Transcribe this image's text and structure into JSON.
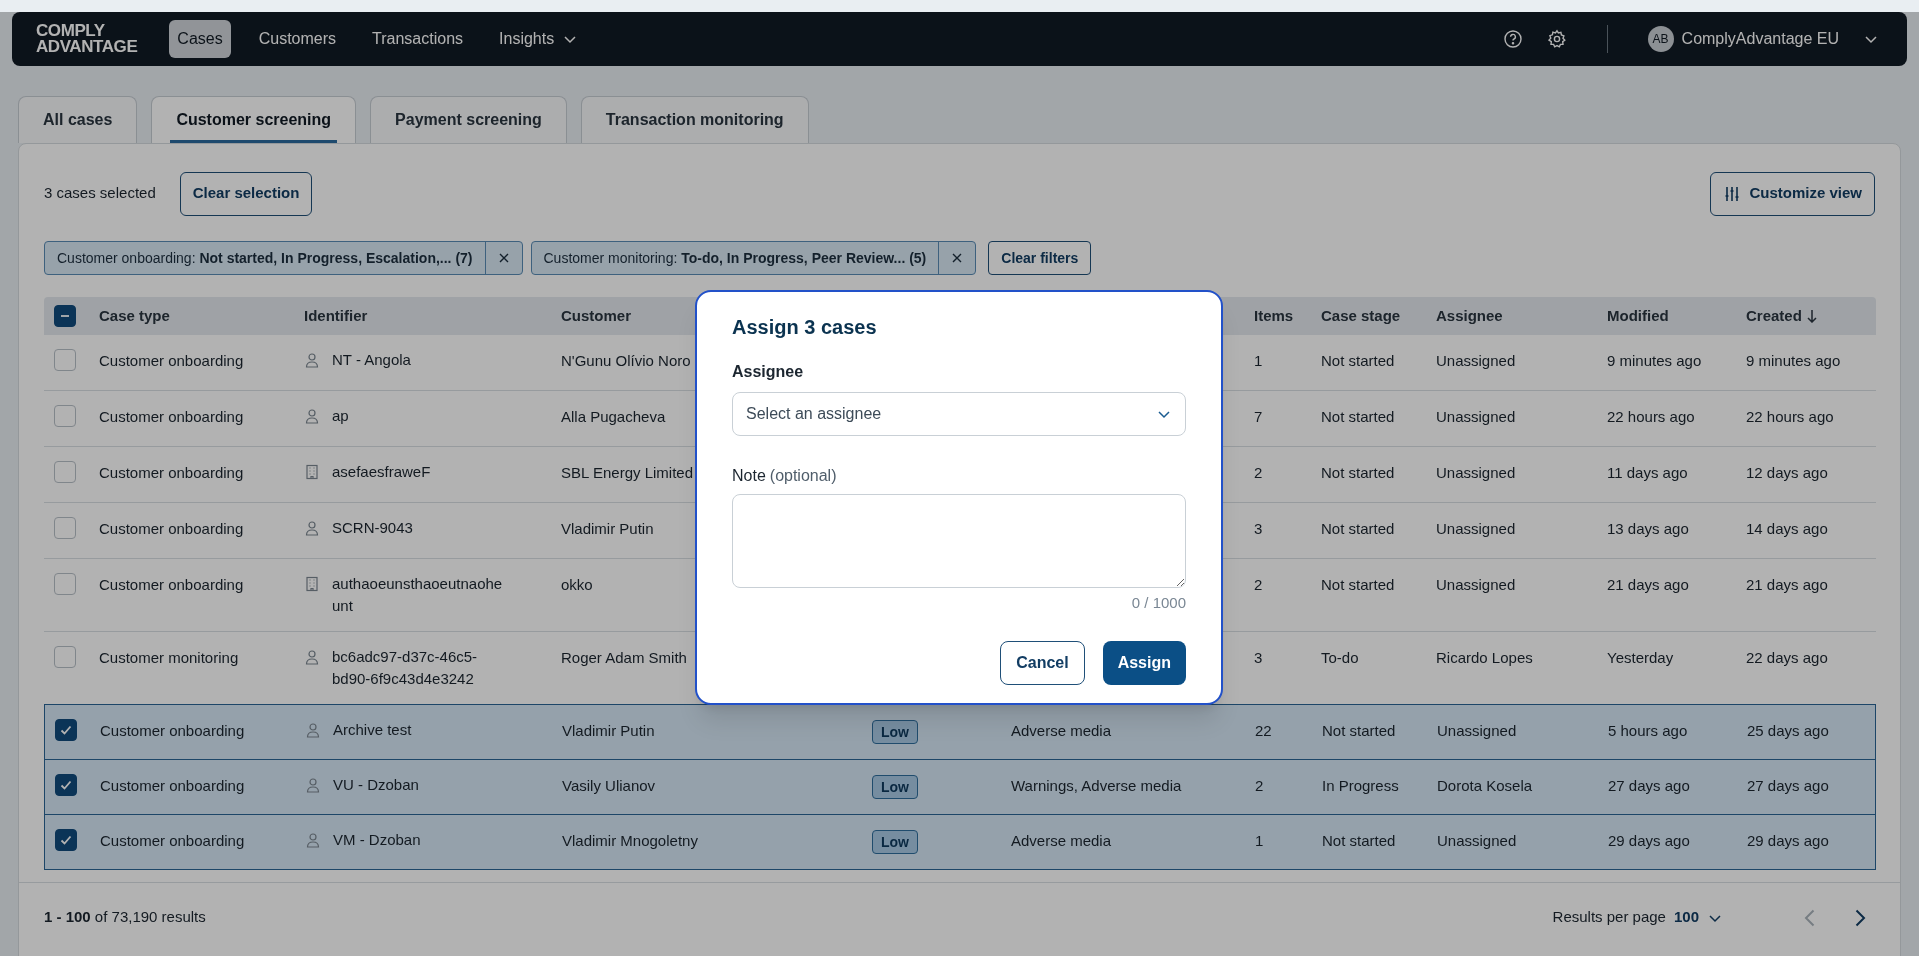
{
  "nav": {
    "logo_line_1": "COMPLY",
    "logo_line_2": "ADVANTAGE",
    "items": [
      {
        "label": "Cases",
        "selected": true,
        "kind": "link"
      },
      {
        "label": "Customers",
        "selected": false,
        "kind": "link"
      },
      {
        "label": "Transactions",
        "selected": false,
        "kind": "link"
      },
      {
        "label": "Insights",
        "selected": false,
        "kind": "dropdown"
      }
    ],
    "avatar_initials": "AB",
    "account": "ComplyAdvantage EU"
  },
  "tabs": [
    {
      "label": "All cases",
      "selected": false
    },
    {
      "label": "Customer screening",
      "selected": true
    },
    {
      "label": "Payment screening",
      "selected": false
    },
    {
      "label": "Transaction monitoring",
      "selected": false
    }
  ],
  "selection": {
    "count_text": "3 cases selected",
    "clear_button": "Clear selection"
  },
  "customize_button": "Customize view",
  "filters": [
    {
      "text": "Customer onboarding: **Not started, In Progress, Escalation,... (7)**"
    },
    {
      "text": "Customer monitoring: **To-do, In Progress, Peer Review... (5)**"
    }
  ],
  "clear_filters": "Clear filters",
  "table": {
    "select_all_indeterminate": true,
    "columns": [
      {
        "label": "Case type"
      },
      {
        "label": "Identifier"
      },
      {
        "label": "Customer"
      },
      {},
      {},
      {
        "label": "Items"
      },
      {
        "label": "Case stage"
      },
      {
        "label": "Assignee"
      },
      {
        "label": "Modified"
      },
      {
        "label": "Created",
        "sorted_descending": true
      }
    ],
    "rows": [
      {
        "selected": false,
        "case_type": "Customer onboarding",
        "identifier": {
          "kind": "person",
          "text": "NT - Angola"
        },
        "customer": "N'Gunu Olívio Noro",
        "items": "1",
        "case_stage": "Not started",
        "assignee": "Unassigned",
        "modified": "9 minutes ago",
        "created": "9 minutes ago"
      },
      {
        "selected": false,
        "case_type": "Customer onboarding",
        "identifier": {
          "kind": "person",
          "text": "ap"
        },
        "customer": "Alla Pugacheva",
        "items": "7",
        "case_stage": "Not started",
        "assignee": "Unassigned",
        "modified": "22 hours ago",
        "created": "22 hours ago"
      },
      {
        "selected": false,
        "case_type": "Customer onboarding",
        "identifier": {
          "kind": "company",
          "text": "asefaesfraweF"
        },
        "customer": "SBL Energy Limited",
        "items": "2",
        "case_stage": "Not started",
        "assignee": "Unassigned",
        "modified": "11 days ago",
        "created": "12 days ago"
      },
      {
        "selected": false,
        "case_type": "Customer onboarding",
        "identifier": {
          "kind": "person",
          "text": "SCRN-9043"
        },
        "customer": "Vladimir Putin",
        "items": "3",
        "case_stage": "Not started",
        "assignee": "Unassigned",
        "modified": "13 days ago",
        "created": "14 days ago"
      },
      {
        "selected": false,
        "case_type": "Customer onboarding",
        "identifier": {
          "kind": "company",
          "text": "authaoeunsthaoeutnaoheunt"
        },
        "customer": "okko",
        "items": "2",
        "case_stage": "Not started",
        "assignee": "Unassigned",
        "modified": "21 days ago",
        "created": "21 days ago"
      },
      {
        "selected": false,
        "case_type": "Customer monitoring",
        "identifier": {
          "kind": "person",
          "text": "bc6adc97-d37c-46c5-bd90-6f9c43d4e3242"
        },
        "customer": "Roger Adam Smith",
        "items": "3",
        "case_stage": "To-do",
        "assignee": "Ricardo Lopes",
        "modified": "Yesterday",
        "created": "22 days ago"
      },
      {
        "selected": true,
        "case_type": "Customer onboarding",
        "identifier": {
          "kind": "person",
          "text": "Archive test"
        },
        "customer": "Vladimir Putin",
        "column_4": "Low",
        "column_5": "Adverse media",
        "items": "22",
        "case_stage": "Not started",
        "assignee": "Unassigned",
        "modified": "5 hours ago",
        "created": "25 days ago"
      },
      {
        "selected": true,
        "case_type": "Customer onboarding",
        "identifier": {
          "kind": "person",
          "text": "VU - Dzoban"
        },
        "customer": "Vasily Ulianov",
        "column_4": "Low",
        "column_5": "Warnings, Adverse media",
        "items": "2",
        "case_stage": "In Progress",
        "assignee": "Dorota Kosela",
        "modified": "27 days ago",
        "created": "27 days ago"
      },
      {
        "selected": true,
        "case_type": "Customer onboarding",
        "identifier": {
          "kind": "person",
          "text": "VM - Dzoban"
        },
        "customer": "Vladimir Mnogoletny",
        "column_4": "Low",
        "column_5": "Adverse media",
        "items": "1",
        "case_stage": "Not started",
        "assignee": "Unassigned",
        "modified": "29 days ago",
        "created": "29 days ago"
      }
    ]
  },
  "footer": {
    "results": "**1 - 100** of 73,190 results",
    "per_page_label": "Results per page",
    "per_page_value": "100",
    "prev_disabled": true,
    "next_disabled": false
  },
  "modal": {
    "title": "Assign 3 cases",
    "assignee_label": "Assignee",
    "assignee_placeholder": "Select an assignee",
    "note_label": "Note",
    "note_hint": "(optional)",
    "counter": "0 / 1000",
    "cancel": "Cancel",
    "assign": "Assign"
  }
}
